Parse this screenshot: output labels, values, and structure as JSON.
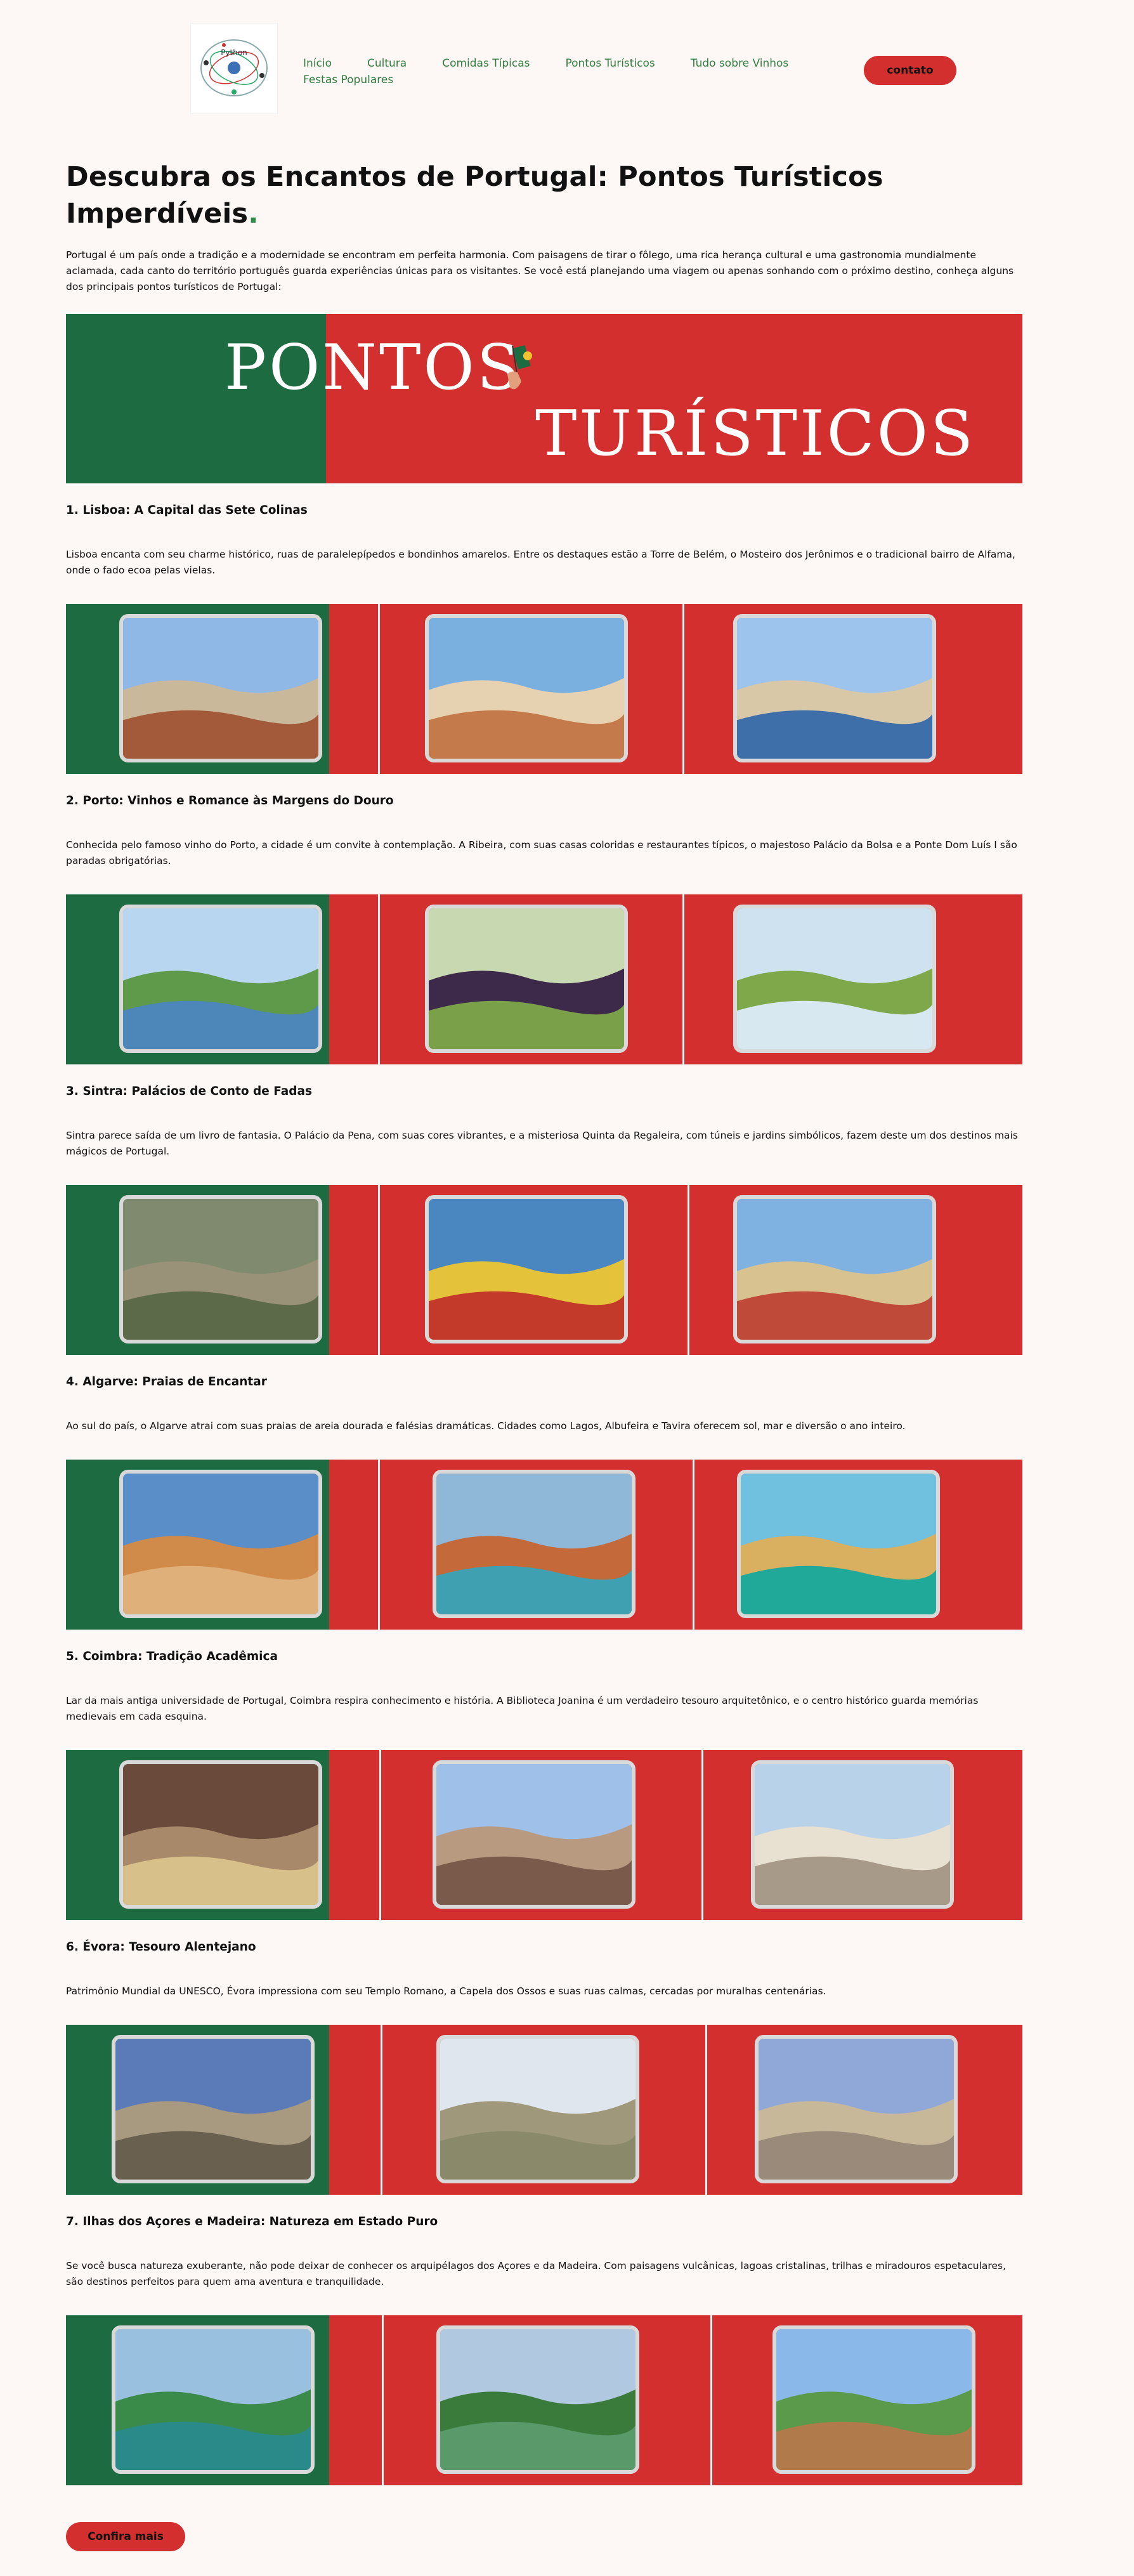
{
  "header": {
    "logo_text": "Python",
    "nav": [
      "Início",
      "Cultura",
      "Comidas Típicas",
      "Pontos Turísticos",
      "Tudo sobre Vinhos"
    ],
    "nav_second": "Festas Populares",
    "contact_label": "contato"
  },
  "main": {
    "title": "Descubra os Encantos de Portugal: Pontos Turísticos Imperdíveis",
    "title_dot": ".",
    "intro": "Portugal é um país onde a tradição e a modernidade se encontram em perfeita harmonia. Com paisagens de tirar o fôlego, uma rica herança cultural e uma gastronomia mundialmente aclamada, cada canto do território português guarda experiências únicas para os visitantes. Se você está planejando uma viagem ou apenas sonhando com o próximo destino, conheça alguns dos principais pontos turísticos de Portugal:",
    "banner_line1": "PONTOS",
    "banner_line2": "TURÍSTICOS"
  },
  "colors": {
    "green": "#1d6b40",
    "red": "#d32f2f",
    "link": "#2f7d3e"
  },
  "sections": [
    {
      "title": "1. Lisboa: A Capital das Sete Colinas",
      "text": "Lisboa encanta com seu charme histórico, ruas de paralelepípedos e bondinhos amarelos. Entre os destaques estão a Torre de Belém, o Mosteiro dos Jerônimos e o tradicional bairro de Alfama, onde o fado ecoa pelas vielas.",
      "photos": [
        "lisbon-hillside-photo",
        "lisbon-view-photo",
        "praca-do-comercio-photo"
      ]
    },
    {
      "title": "2. Porto: Vinhos e Romance às Margens do Douro",
      "text": "Conhecida pelo famoso vinho do Porto, a cidade é um convite à contemplação. A Ribeira, com suas casas coloridas e restaurantes típicos, o majestoso Palácio da Bolsa e a Ponte Dom Luís I são paradas obrigatórias.",
      "photos": [
        "douro-valley-photo",
        "grapes-photo",
        "wine-glass-vineyard-photo"
      ]
    },
    {
      "title": "3. Sintra: Palácios de Conto de Fadas",
      "text": "Sintra parece saída de um livro de fantasia. O Palácio da Pena, com suas cores vibrantes, e a misteriosa Quinta da Regaleira, com túneis e jardins simbólicos, fazem deste um dos destinos mais mágicos de Portugal.",
      "photos": [
        "quinta-regaleira-photo",
        "pena-palace-photo",
        "pena-palace-arches-photo"
      ]
    },
    {
      "title": "4. Algarve: Praias de Encantar",
      "text": "Ao sul do país, o Algarve atrai com suas praias de areia dourada e falésias dramáticas. Cidades como Lagos, Albufeira e Tavira oferecem sol, mar e diversão o ano inteiro.",
      "photos": [
        "algarve-cliffs-photo",
        "algarve-beach-photo",
        "algarve-coast-photo"
      ]
    },
    {
      "title": "5. Coimbra: Tradição Acadêmica",
      "text": "Lar da mais antiga universidade de Portugal, Coimbra respira conhecimento e história. A Biblioteca Joanina é um verdadeiro tesouro arquitetônico, e o centro histórico guarda memórias medievais em cada esquina.",
      "photos": [
        "coimbra-chapel-photo",
        "coimbra-university-photo",
        "coimbra-courtyard-photo"
      ]
    },
    {
      "title": "6. Évora: Tesouro Alentejano",
      "text": "Patrimônio Mundial da UNESCO, Évora impressiona com seu Templo Romano, a Capela dos Ossos e suas ruas calmas, cercadas por muralhas centenárias.",
      "photos": [
        "roman-temple-photo",
        "roman-temple-square-photo",
        "roman-temple-columns-photo"
      ]
    },
    {
      "title": "7. Ilhas dos Açores e Madeira: Natureza em Estado Puro",
      "text": "Se você busca natureza exuberante, não pode deixar de conhecer os arquipélagos dos Açores e da Madeira. Com paisagens vulcânicas, lagoas cristalinas, trilhas e miradouros espetaculares, são destinos perfeitos para quem ama aventura e tranquilidade.",
      "photos": [
        "azores-lagoon-photo",
        "azores-crater-photo",
        "madeira-trail-photo"
      ]
    }
  ],
  "more_label": "Confira mais"
}
